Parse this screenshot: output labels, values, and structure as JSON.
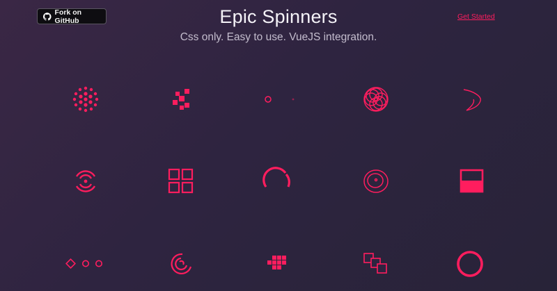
{
  "header": {
    "github_button": {
      "label": "Fork on GitHub",
      "icon": "github-icon"
    },
    "title": "Epic Spinners",
    "subtitle": "Css only. Easy to use. VueJS integration.",
    "get_started_link": "Get Started"
  },
  "colors": {
    "accent": "#ff1d5e",
    "background": "#2e2440",
    "title": "#f4f2f7",
    "subtitle": "#c3bccd"
  },
  "spinners": [
    {
      "icon": "fingerprint-dots-spinner"
    },
    {
      "icon": "pixel-cross-spinner"
    },
    {
      "icon": "orbit-dot-spinner"
    },
    {
      "icon": "semipolar-circles-spinner"
    },
    {
      "icon": "swapping-curves-spinner"
    },
    {
      "icon": "signal-rings-spinner"
    },
    {
      "icon": "four-squares-spinner"
    },
    {
      "icon": "half-circle-spinner"
    },
    {
      "icon": "trinity-rings-spinner"
    },
    {
      "icon": "filling-square-spinner"
    },
    {
      "icon": "dots-spinner"
    },
    {
      "icon": "spring-arcs-spinner"
    },
    {
      "icon": "pixel-blocks-spinner"
    },
    {
      "icon": "stacked-squares-spinner"
    },
    {
      "icon": "ring-spinner"
    }
  ]
}
